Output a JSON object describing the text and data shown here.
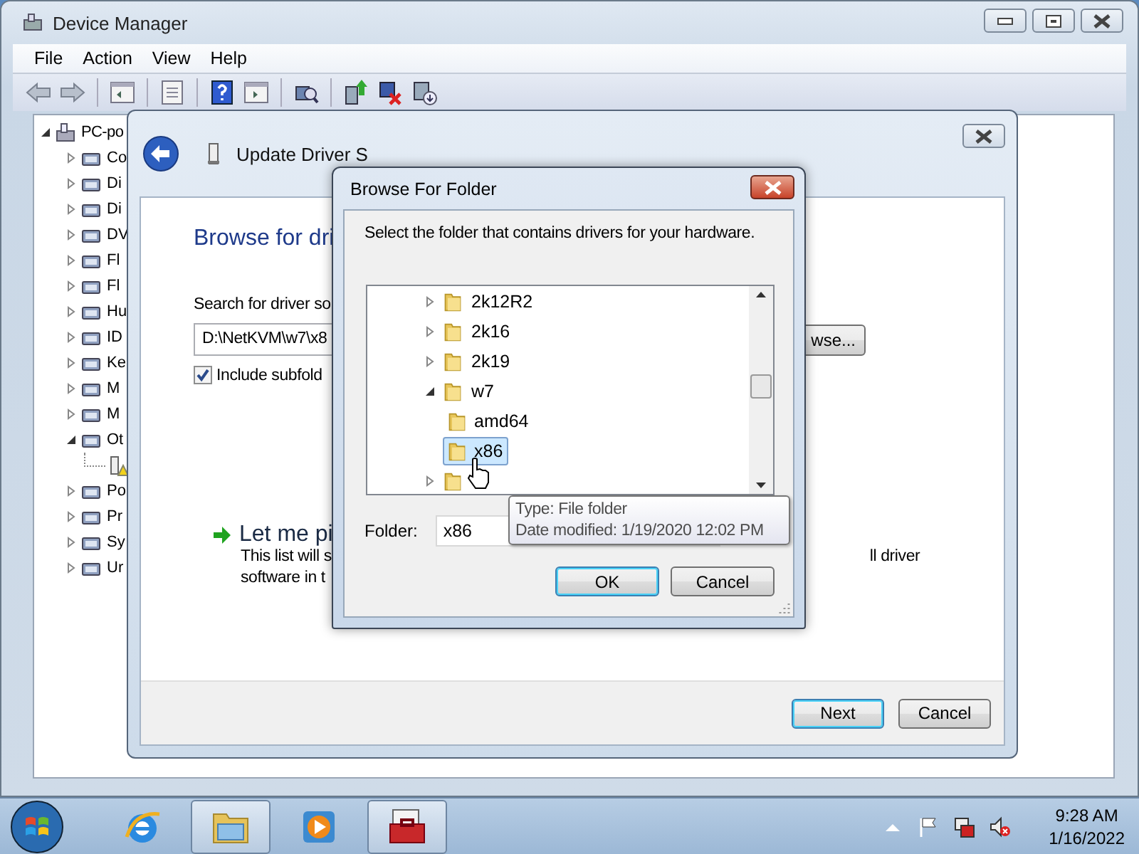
{
  "device_manager": {
    "title": "Device Manager",
    "menu": [
      "File",
      "Action",
      "View",
      "Help"
    ],
    "tree": {
      "label": "PC-po",
      "expanded": true,
      "children": [
        {
          "label": "Co",
          "expanded": false
        },
        {
          "label": "Di",
          "expanded": false
        },
        {
          "label": "Di",
          "expanded": false
        },
        {
          "label": "DV",
          "expanded": false
        },
        {
          "label": "Fl",
          "expanded": false
        },
        {
          "label": "Fl",
          "expanded": false
        },
        {
          "label": "Hu",
          "expanded": false
        },
        {
          "label": "ID",
          "expanded": false
        },
        {
          "label": "Ke",
          "expanded": false
        },
        {
          "label": "M",
          "expanded": false
        },
        {
          "label": "M",
          "expanded": false
        },
        {
          "label": "Ot",
          "expanded": true,
          "children": [
            {
              "kind": "warning"
            }
          ]
        },
        {
          "label": "Po",
          "expanded": false
        },
        {
          "label": "Pr",
          "expanded": false
        },
        {
          "label": "Sy",
          "expanded": false
        },
        {
          "label": "Ur",
          "expanded": false
        }
      ]
    }
  },
  "update_driver": {
    "title": "Update Driver S",
    "heading": "Browse for dri",
    "search_label": "Search for driver so",
    "path": "D:\\NetKVM\\w7\\x8",
    "include_subfolders": {
      "label": "Include subfold",
      "checked": true
    },
    "browse_button": "wse...",
    "pick_option": {
      "title": "Let me pi",
      "lines": [
        "This list will s",
        "software in t"
      ],
      "right_text": "ll driver"
    },
    "buttons": [
      {
        "label": "Next",
        "default": true
      },
      {
        "label": "Cancel",
        "default": false
      }
    ]
  },
  "browse_dialog": {
    "title": "Browse For Folder",
    "prompt": "Select the folder that contains drivers for your hardware.",
    "folders": [
      {
        "label": "2k12R2",
        "expanded": false,
        "selected": false
      },
      {
        "label": "2k16",
        "expanded": false,
        "selected": false
      },
      {
        "label": "2k19",
        "expanded": false,
        "selected": false
      },
      {
        "label": "w7",
        "expanded": true,
        "selected": false,
        "children": [
          {
            "label": "amd64",
            "selected": false
          },
          {
            "label": "x86",
            "selected": true
          }
        ]
      },
      {
        "expanded": false,
        "selected": false
      }
    ],
    "folder_label": "Folder:",
    "folder_value": "x86",
    "tooltip": [
      "Type: File folder",
      "Date modified: 1/19/2020 12:02 PM"
    ],
    "buttons": [
      {
        "label": "OK",
        "default": true
      },
      {
        "label": "Cancel",
        "default": false
      }
    ]
  },
  "taskbar": {
    "apps": [
      {
        "kind": "browser",
        "active": false
      },
      {
        "kind": "explorer",
        "active": true
      },
      {
        "kind": "media",
        "active": false
      },
      {
        "kind": "toolbox",
        "active": true
      }
    ],
    "tray": [
      {
        "kind": "arrow"
      },
      {
        "kind": "flag"
      },
      {
        "kind": "network"
      },
      {
        "kind": "volume"
      }
    ],
    "time": "9:28 AM",
    "date": "1/16/2022"
  }
}
